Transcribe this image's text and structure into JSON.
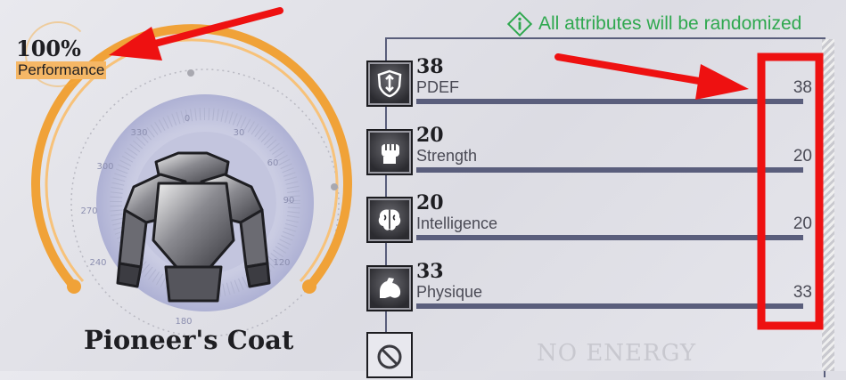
{
  "performance": {
    "value": "100%",
    "label": "Performance"
  },
  "item": {
    "name": "Pioneer's Coat"
  },
  "dial": {
    "ticks": [
      "0",
      "30",
      "60",
      "90",
      "120",
      "180",
      "240",
      "270",
      "300",
      "330"
    ]
  },
  "banner": {
    "text": "All attributes will be randomized",
    "icon": "info-diamond-icon",
    "color": "#2fa84f"
  },
  "attributes": [
    {
      "value": "38",
      "label": "PDEF",
      "right_value": "38",
      "icon": "shield-icon"
    },
    {
      "value": "20",
      "label": "Strength",
      "right_value": "20",
      "icon": "fist-icon"
    },
    {
      "value": "20",
      "label": "Intelligence",
      "right_value": "20",
      "icon": "brain-icon"
    },
    {
      "value": "33",
      "label": "Physique",
      "right_value": "33",
      "icon": "arm-muscle-icon"
    }
  ],
  "footer": {
    "text": "NO ENERGY",
    "icon": "prohibited-icon"
  },
  "colors": {
    "gauge": "#f5a53a",
    "panel_border": "#595e7b",
    "annotation": "#ee1111"
  }
}
